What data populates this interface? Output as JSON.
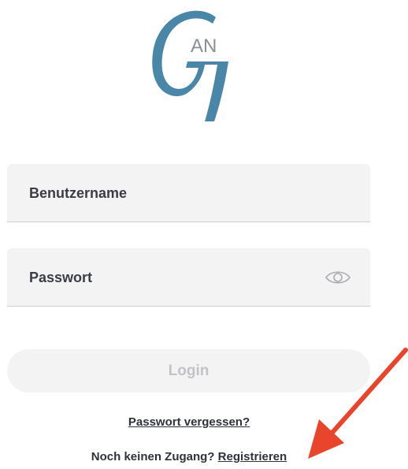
{
  "logo": {
    "text_top": "AN",
    "text_big": "G",
    "color": "#4a86a8"
  },
  "form": {
    "username_placeholder": "Benutzername",
    "password_placeholder": "Passwort",
    "password_toggle_icon": "eye-icon",
    "login_label": "Login"
  },
  "links": {
    "forgot_password": "Passwort vergessen?",
    "no_account": "Noch keinen Zugang?",
    "register": "Registrieren"
  },
  "annotation": {
    "arrow_icon": "red-arrow-icon",
    "color": "#e8452c"
  }
}
